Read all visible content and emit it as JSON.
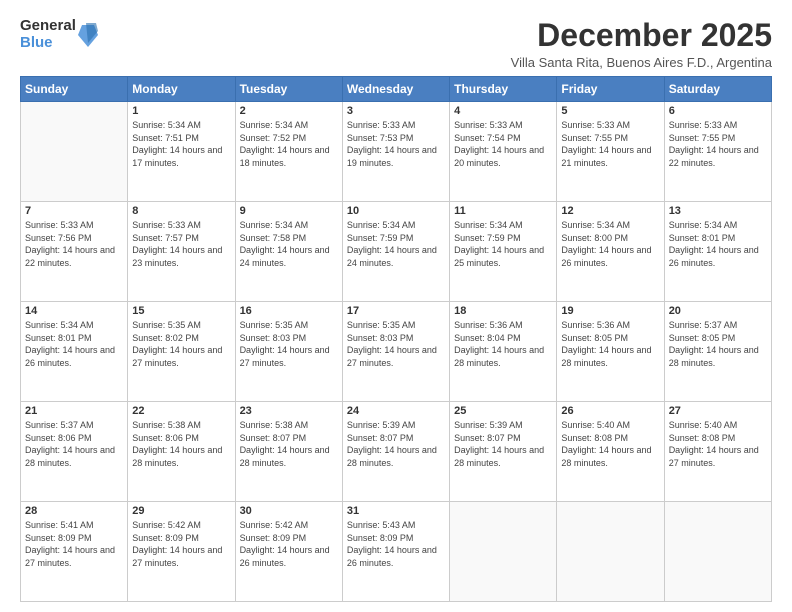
{
  "header": {
    "logo_general": "General",
    "logo_blue": "Blue",
    "month_title": "December 2025",
    "subtitle": "Villa Santa Rita, Buenos Aires F.D., Argentina"
  },
  "days_of_week": [
    "Sunday",
    "Monday",
    "Tuesday",
    "Wednesday",
    "Thursday",
    "Friday",
    "Saturday"
  ],
  "weeks": [
    [
      {
        "day": "",
        "sunrise": "",
        "sunset": "",
        "daylight": ""
      },
      {
        "day": "1",
        "sunrise": "Sunrise: 5:34 AM",
        "sunset": "Sunset: 7:51 PM",
        "daylight": "Daylight: 14 hours and 17 minutes."
      },
      {
        "day": "2",
        "sunrise": "Sunrise: 5:34 AM",
        "sunset": "Sunset: 7:52 PM",
        "daylight": "Daylight: 14 hours and 18 minutes."
      },
      {
        "day": "3",
        "sunrise": "Sunrise: 5:33 AM",
        "sunset": "Sunset: 7:53 PM",
        "daylight": "Daylight: 14 hours and 19 minutes."
      },
      {
        "day": "4",
        "sunrise": "Sunrise: 5:33 AM",
        "sunset": "Sunset: 7:54 PM",
        "daylight": "Daylight: 14 hours and 20 minutes."
      },
      {
        "day": "5",
        "sunrise": "Sunrise: 5:33 AM",
        "sunset": "Sunset: 7:55 PM",
        "daylight": "Daylight: 14 hours and 21 minutes."
      },
      {
        "day": "6",
        "sunrise": "Sunrise: 5:33 AM",
        "sunset": "Sunset: 7:55 PM",
        "daylight": "Daylight: 14 hours and 22 minutes."
      }
    ],
    [
      {
        "day": "7",
        "sunrise": "Sunrise: 5:33 AM",
        "sunset": "Sunset: 7:56 PM",
        "daylight": "Daylight: 14 hours and 22 minutes."
      },
      {
        "day": "8",
        "sunrise": "Sunrise: 5:33 AM",
        "sunset": "Sunset: 7:57 PM",
        "daylight": "Daylight: 14 hours and 23 minutes."
      },
      {
        "day": "9",
        "sunrise": "Sunrise: 5:34 AM",
        "sunset": "Sunset: 7:58 PM",
        "daylight": "Daylight: 14 hours and 24 minutes."
      },
      {
        "day": "10",
        "sunrise": "Sunrise: 5:34 AM",
        "sunset": "Sunset: 7:59 PM",
        "daylight": "Daylight: 14 hours and 24 minutes."
      },
      {
        "day": "11",
        "sunrise": "Sunrise: 5:34 AM",
        "sunset": "Sunset: 7:59 PM",
        "daylight": "Daylight: 14 hours and 25 minutes."
      },
      {
        "day": "12",
        "sunrise": "Sunrise: 5:34 AM",
        "sunset": "Sunset: 8:00 PM",
        "daylight": "Daylight: 14 hours and 26 minutes."
      },
      {
        "day": "13",
        "sunrise": "Sunrise: 5:34 AM",
        "sunset": "Sunset: 8:01 PM",
        "daylight": "Daylight: 14 hours and 26 minutes."
      }
    ],
    [
      {
        "day": "14",
        "sunrise": "Sunrise: 5:34 AM",
        "sunset": "Sunset: 8:01 PM",
        "daylight": "Daylight: 14 hours and 26 minutes."
      },
      {
        "day": "15",
        "sunrise": "Sunrise: 5:35 AM",
        "sunset": "Sunset: 8:02 PM",
        "daylight": "Daylight: 14 hours and 27 minutes."
      },
      {
        "day": "16",
        "sunrise": "Sunrise: 5:35 AM",
        "sunset": "Sunset: 8:03 PM",
        "daylight": "Daylight: 14 hours and 27 minutes."
      },
      {
        "day": "17",
        "sunrise": "Sunrise: 5:35 AM",
        "sunset": "Sunset: 8:03 PM",
        "daylight": "Daylight: 14 hours and 27 minutes."
      },
      {
        "day": "18",
        "sunrise": "Sunrise: 5:36 AM",
        "sunset": "Sunset: 8:04 PM",
        "daylight": "Daylight: 14 hours and 28 minutes."
      },
      {
        "day": "19",
        "sunrise": "Sunrise: 5:36 AM",
        "sunset": "Sunset: 8:05 PM",
        "daylight": "Daylight: 14 hours and 28 minutes."
      },
      {
        "day": "20",
        "sunrise": "Sunrise: 5:37 AM",
        "sunset": "Sunset: 8:05 PM",
        "daylight": "Daylight: 14 hours and 28 minutes."
      }
    ],
    [
      {
        "day": "21",
        "sunrise": "Sunrise: 5:37 AM",
        "sunset": "Sunset: 8:06 PM",
        "daylight": "Daylight: 14 hours and 28 minutes."
      },
      {
        "day": "22",
        "sunrise": "Sunrise: 5:38 AM",
        "sunset": "Sunset: 8:06 PM",
        "daylight": "Daylight: 14 hours and 28 minutes."
      },
      {
        "day": "23",
        "sunrise": "Sunrise: 5:38 AM",
        "sunset": "Sunset: 8:07 PM",
        "daylight": "Daylight: 14 hours and 28 minutes."
      },
      {
        "day": "24",
        "sunrise": "Sunrise: 5:39 AM",
        "sunset": "Sunset: 8:07 PM",
        "daylight": "Daylight: 14 hours and 28 minutes."
      },
      {
        "day": "25",
        "sunrise": "Sunrise: 5:39 AM",
        "sunset": "Sunset: 8:07 PM",
        "daylight": "Daylight: 14 hours and 28 minutes."
      },
      {
        "day": "26",
        "sunrise": "Sunrise: 5:40 AM",
        "sunset": "Sunset: 8:08 PM",
        "daylight": "Daylight: 14 hours and 28 minutes."
      },
      {
        "day": "27",
        "sunrise": "Sunrise: 5:40 AM",
        "sunset": "Sunset: 8:08 PM",
        "daylight": "Daylight: 14 hours and 27 minutes."
      }
    ],
    [
      {
        "day": "28",
        "sunrise": "Sunrise: 5:41 AM",
        "sunset": "Sunset: 8:09 PM",
        "daylight": "Daylight: 14 hours and 27 minutes."
      },
      {
        "day": "29",
        "sunrise": "Sunrise: 5:42 AM",
        "sunset": "Sunset: 8:09 PM",
        "daylight": "Daylight: 14 hours and 27 minutes."
      },
      {
        "day": "30",
        "sunrise": "Sunrise: 5:42 AM",
        "sunset": "Sunset: 8:09 PM",
        "daylight": "Daylight: 14 hours and 26 minutes."
      },
      {
        "day": "31",
        "sunrise": "Sunrise: 5:43 AM",
        "sunset": "Sunset: 8:09 PM",
        "daylight": "Daylight: 14 hours and 26 minutes."
      },
      {
        "day": "",
        "sunrise": "",
        "sunset": "",
        "daylight": ""
      },
      {
        "day": "",
        "sunrise": "",
        "sunset": "",
        "daylight": ""
      },
      {
        "day": "",
        "sunrise": "",
        "sunset": "",
        "daylight": ""
      }
    ]
  ]
}
